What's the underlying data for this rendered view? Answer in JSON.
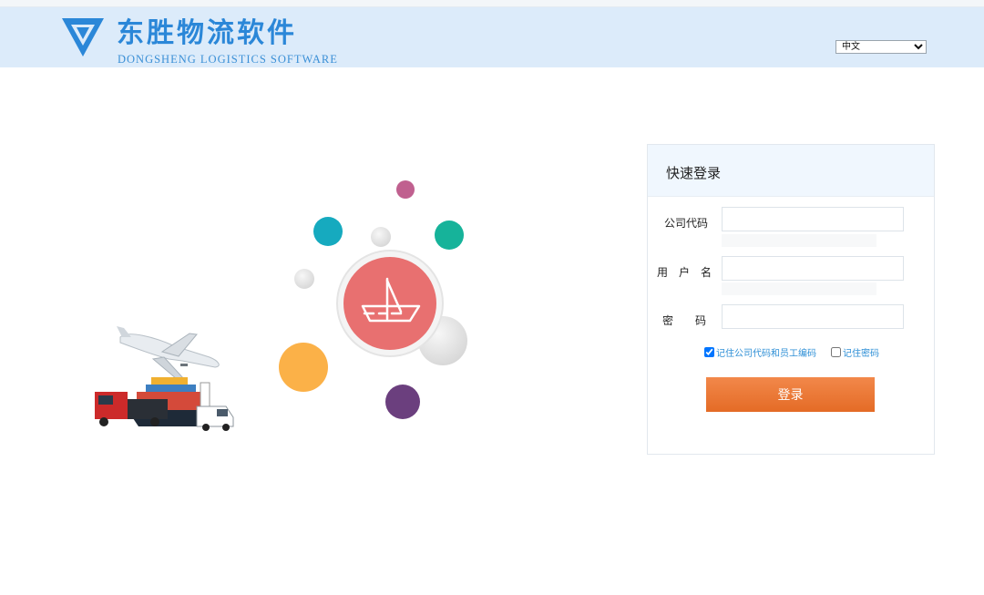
{
  "brand": {
    "name_cn": "东胜物流软件",
    "name_en": "DONGSHENG LOGISTICS SOFTWARE",
    "color": "#2b87d8"
  },
  "header": {
    "language_selected": "中文",
    "language_options": [
      "中文"
    ]
  },
  "login": {
    "title": "快速登录",
    "company_code_label": "公司代码",
    "username_label": "用　户　名",
    "password_label": "密　　码",
    "company_code_value": "",
    "username_value": "",
    "password_value": "",
    "remember_company": {
      "label": "记住公司代码和员工编码",
      "checked": true
    },
    "remember_password": {
      "label": "记住密码",
      "checked": false
    },
    "submit_label": "登录",
    "button_color": "#e8742f"
  },
  "illustration": {
    "center_icon": "ship-sail-icon",
    "bubble_colors": [
      "#c0608f",
      "#16aabf",
      "#16b39a",
      "#fbb148",
      "#6b3f7e",
      "#e87070"
    ]
  }
}
